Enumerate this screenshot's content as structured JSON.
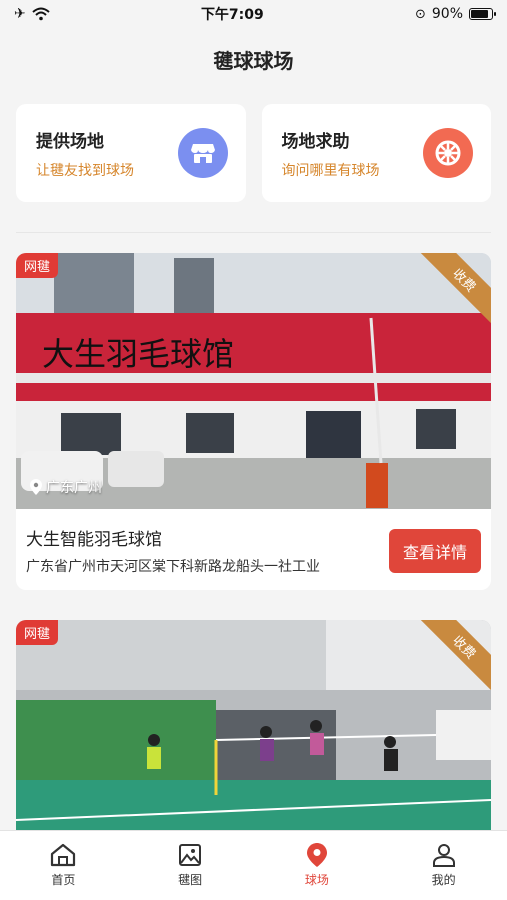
{
  "status": {
    "time": "下午7:09",
    "battery": "90%",
    "battery_level": 0.9
  },
  "header": {
    "title": "毽球球场"
  },
  "quick_cards": [
    {
      "title": "提供场地",
      "subtitle": "让毽友找到球场",
      "icon": "storefront-icon",
      "color": "#7b8ff0"
    },
    {
      "title": "场地求助",
      "subtitle": "询问哪里有球场",
      "icon": "lifebuoy-icon",
      "color": "#f26a52"
    }
  ],
  "venues": [
    {
      "tag": "网毽",
      "ribbon": "收费",
      "location": "广东广州",
      "sign_text": "大生羽毛球馆",
      "name": "大生智能羽毛球馆",
      "address": "广东省广州市天河区棠下科新路龙船头一社工业",
      "button": "查看详情"
    },
    {
      "tag": "网毽",
      "ribbon": "收费"
    }
  ],
  "tabs": [
    {
      "label": "首页",
      "icon": "home-icon",
      "active": false
    },
    {
      "label": "毽图",
      "icon": "image-icon",
      "active": false
    },
    {
      "label": "球场",
      "icon": "map-pin-icon",
      "active": true
    },
    {
      "label": "我的",
      "icon": "user-icon",
      "active": false
    }
  ],
  "colors": {
    "accent": "#e0463a",
    "gold": "#d6862c"
  }
}
